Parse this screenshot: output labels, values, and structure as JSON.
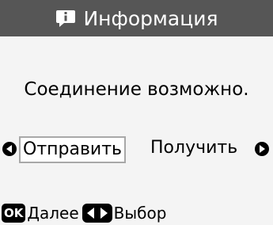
{
  "header": {
    "title": "Информация",
    "icon": "info-bubble-icon"
  },
  "message": {
    "text": "Соединение возможно."
  },
  "selector": {
    "options": [
      {
        "label": "Отправить",
        "selected": true
      },
      {
        "label": "Получить",
        "selected": false
      }
    ],
    "left_icon": "arrow-left-icon",
    "right_icon": "arrow-right-icon"
  },
  "footer": {
    "ok_badge": "OK",
    "ok_label": "Далее",
    "nav_icon": "left-right-nav-icon",
    "nav_label": "Выбор"
  },
  "colors": {
    "header_bg": "#565656",
    "header_fg": "#ffffff",
    "selection_border": "#a8a8a8"
  }
}
